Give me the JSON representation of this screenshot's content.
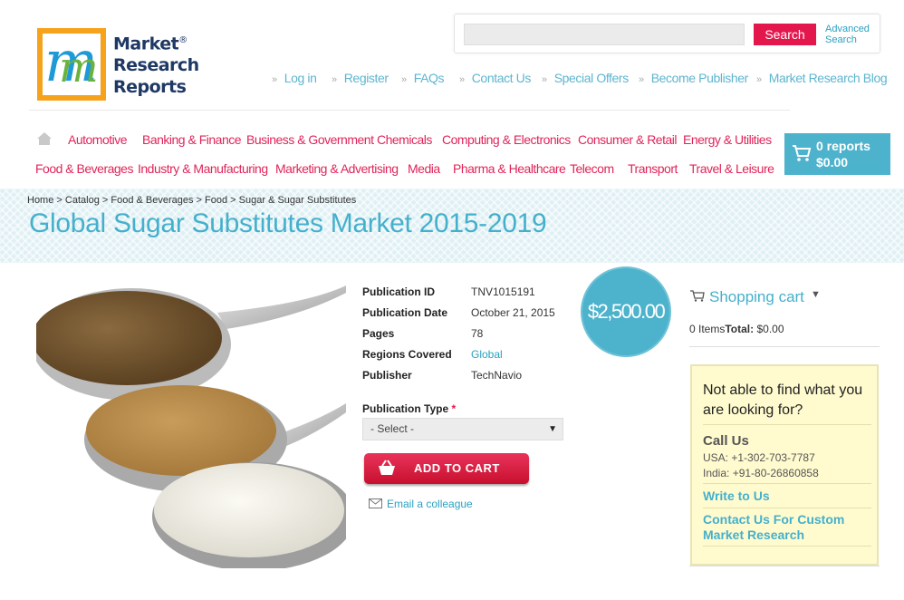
{
  "brand": {
    "logo_line1": "Market",
    "logo_line2": "Research",
    "logo_line3": "Reports",
    "registered": "®",
    "logo_letter": "m"
  },
  "search": {
    "placeholder": "",
    "button_label": "Search",
    "advanced_line1": "Advanced",
    "advanced_line2": "Search"
  },
  "toplinks": [
    "Log in",
    "Register",
    "FAQs",
    "Contact Us",
    "Special Offers",
    "Become Publisher",
    "Market Research Blog"
  ],
  "nav": {
    "row1": [
      "Automotive",
      "Banking & Finance",
      "Business & Government",
      "Chemicals",
      "Computing & Electronics",
      "Consumer & Retail",
      "Energy & Utilities"
    ],
    "row2": [
      "Food & Beverages",
      "Industry & Manufacturing",
      "Marketing & Advertising",
      "Media",
      "Pharma & Healthcare",
      "Telecom",
      "Transport",
      "Travel & Leisure"
    ]
  },
  "cart_button": {
    "count": "0 reports",
    "total": "$0.00"
  },
  "breadcrumb": [
    "Home",
    "Catalog",
    "Food & Beverages",
    "Food",
    "Sugar & Sugar Substitutes"
  ],
  "breadcrumb_sep": " > ",
  "page_title": "Global Sugar Substitutes Market 2015-2019",
  "product": {
    "price": "$2,500.00",
    "details": [
      {
        "label": "Publication ID",
        "value": "TNV1015191"
      },
      {
        "label": "Publication Date",
        "value": "October 21, 2015"
      },
      {
        "label": "Pages",
        "value": "78"
      },
      {
        "label": "Regions Covered",
        "value": "Global"
      },
      {
        "label": "Publisher",
        "value": "TechNavio"
      }
    ],
    "pub_type_label": "Publication Type",
    "required_mark": "*",
    "select_value": "- Select -",
    "add_to_cart": "ADD TO CART",
    "email_colleague": "Email a colleague"
  },
  "sidebar": {
    "shopping_cart_title": "Shopping cart",
    "items_label": "0 Items",
    "total_label": "Total:",
    "total_value": "$0.00",
    "help_question": "Not able to find what you are looking for?",
    "call_us": "Call Us",
    "phone_usa": "USA: +1-302-703-7787",
    "phone_india": "India: +91-80-26860858",
    "write_to_us": "Write to Us",
    "contact_custom": "Contact Us For Custom Market Research"
  },
  "colors": {
    "accent_teal": "#45b0cc",
    "accent_red": "#e3174c",
    "logo_orange": "#f7a21b",
    "help_bg": "#fffbcf"
  }
}
